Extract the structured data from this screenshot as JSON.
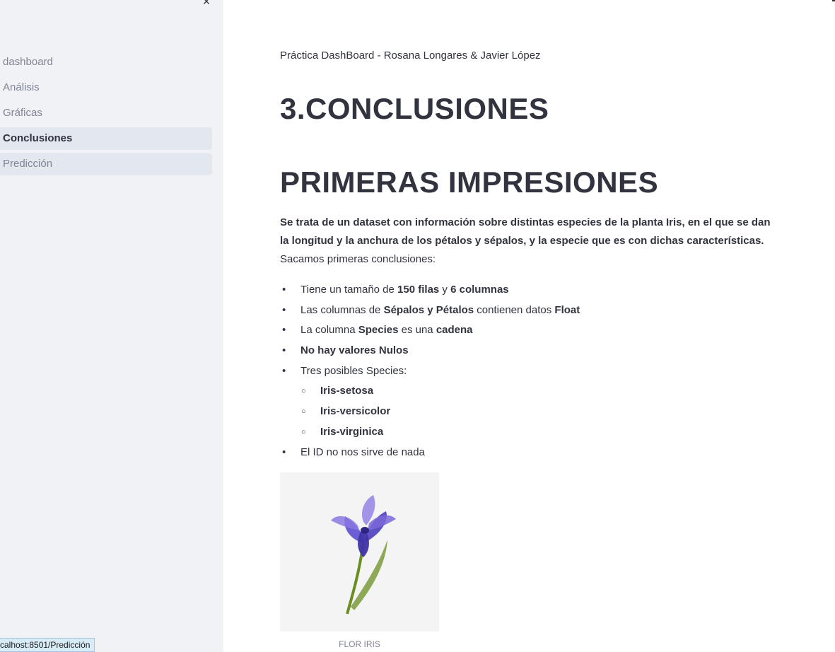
{
  "sidebar": {
    "close_icon": "×",
    "items": [
      {
        "label": "dashboard",
        "state": "normal"
      },
      {
        "label": "Análisis",
        "state": "normal"
      },
      {
        "label": "Gráficas",
        "state": "normal"
      },
      {
        "label": "Conclusiones",
        "state": "active"
      },
      {
        "label": "Predicción",
        "state": "hover"
      }
    ]
  },
  "status_bar": {
    "url": "calhost:8501/Predicción"
  },
  "main": {
    "subtitle": "Práctica DashBoard - Rosana Longares & Javier López",
    "title": "3.CONCLUSIONES",
    "section_title": "PRIMERAS IMPRESIONES",
    "paragraph": {
      "bold": "Se trata de un dataset con información sobre distintas especies de la planta Iris, en el que se dan la longitud y la anchura de los pétalos y sépalos, y la especie que es con dichas características.",
      "normal": " Sacamos primeras conclusiones:"
    },
    "bullets": {
      "b1": {
        "t1": "Tiene un tamaño de ",
        "b1": "150 filas",
        "t2": " y ",
        "b2": "6 columnas"
      },
      "b2": {
        "t1": "Las columnas de ",
        "b1": "Sépalos y Pétalos",
        "t2": " contienen datos ",
        "b2": "Float"
      },
      "b3": {
        "t1": "La columna ",
        "b1": "Species",
        "t2": " es una ",
        "b2": "cadena"
      },
      "b4": {
        "b1": "No hay valores Nulos"
      },
      "b5": {
        "t1": "Tres posibles Species:"
      },
      "sub": [
        "Iris-setosa",
        "Iris-versicolor",
        "Iris-virginica"
      ],
      "b6": {
        "t1": "El ID no nos sirve de nada"
      }
    },
    "image_caption": "FLOR IRIS"
  },
  "colors": {
    "sidebar_bg": "#f0f2f6",
    "active_item_bg": "#e3e7ee",
    "text": "#31333f",
    "muted_text": "#808495",
    "iris_petal": "#6a5acd",
    "iris_stem": "#6b8e23"
  },
  "icons": {
    "close": "close-icon",
    "bullet": "disc-bullet",
    "sub_bullet": "circle-bullet"
  }
}
